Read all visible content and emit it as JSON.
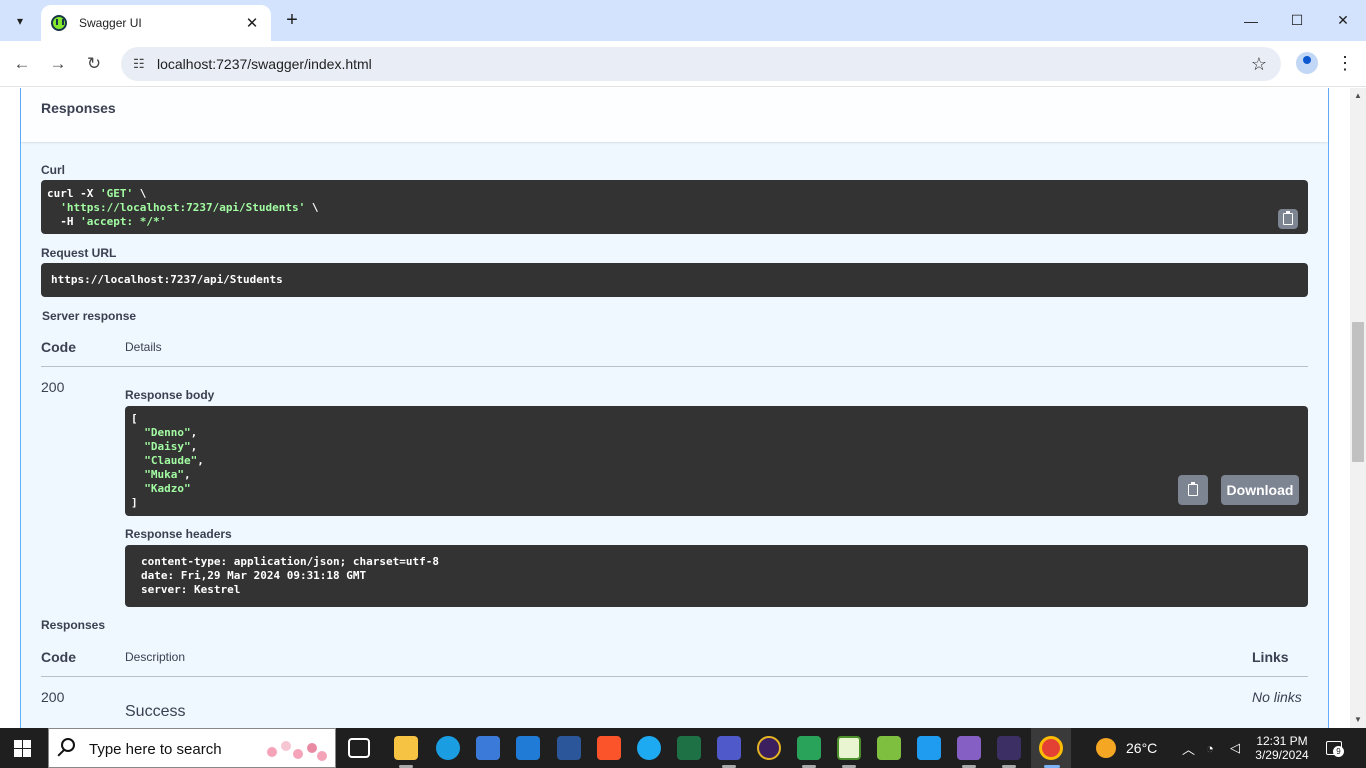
{
  "browser": {
    "tab_title": "Swagger UI",
    "url": "localhost:7237/swagger/index.html"
  },
  "responses_section": {
    "title": "Responses",
    "curl_label": "Curl",
    "curl_line1_cmd": "curl -X ",
    "curl_line1_method": "'GET'",
    "curl_line1_tail": " \\",
    "curl_line2_url": "'https://localhost:7237/api/Students'",
    "curl_line2_tail": " \\",
    "curl_line3_flag": "  -H ",
    "curl_line3_header": "'accept: */*'",
    "request_url_label": "Request URL",
    "request_url": "https://localhost:7237/api/Students",
    "server_response_label": "Server response",
    "code_header": "Code",
    "details_header": "Details",
    "response_code": "200",
    "response_body_label": "Response body",
    "response_body_open": "[",
    "response_body_items": [
      "\"Denno\"",
      "\"Daisy\"",
      "\"Claude\"",
      "\"Muka\"",
      "\"Kadzo\""
    ],
    "response_body_close": "]",
    "download_label": "Download",
    "response_headers_label": "Response headers",
    "response_headers": [
      "content-type: application/json; charset=utf-8",
      "date: Fri,29 Mar 2024 09:31:18 GMT",
      "server: Kestrel"
    ],
    "documented_label": "Responses",
    "doc_code_header": "Code",
    "doc_description_header": "Description",
    "doc_links_header": "Links",
    "doc_code": "200",
    "doc_description": "Success",
    "doc_links": "No links"
  },
  "taskbar": {
    "search_placeholder": "Type here to search",
    "weather": "26°C",
    "time": "12:31 PM",
    "date": "3/29/2024",
    "notification_count": "9"
  }
}
